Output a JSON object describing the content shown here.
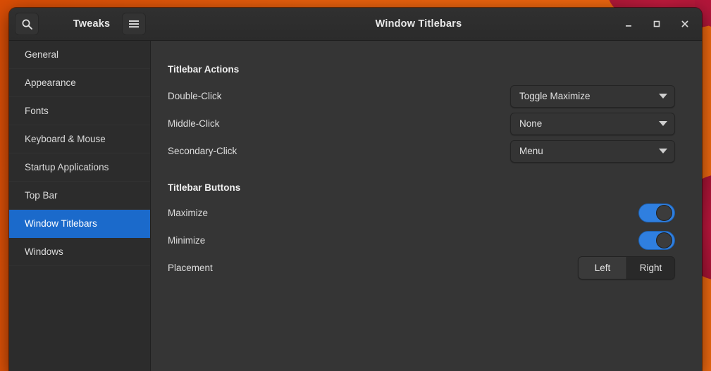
{
  "window": {
    "title": "Window Titlebars",
    "app_name": "Tweaks",
    "search_icon": "search-icon",
    "menu_icon": "hamburger-menu-icon",
    "controls": {
      "minimize": "–",
      "maximize": "□",
      "close": "×"
    }
  },
  "sidebar": {
    "items": [
      {
        "label": "General",
        "selected": false
      },
      {
        "label": "Appearance",
        "selected": false
      },
      {
        "label": "Fonts",
        "selected": false
      },
      {
        "label": "Keyboard & Mouse",
        "selected": false
      },
      {
        "label": "Startup Applications",
        "selected": false
      },
      {
        "label": "Top Bar",
        "selected": false
      },
      {
        "label": "Window Titlebars",
        "selected": true
      },
      {
        "label": "Windows",
        "selected": false
      }
    ]
  },
  "content": {
    "titlebar_actions": {
      "heading": "Titlebar Actions",
      "rows": [
        {
          "label": "Double-Click",
          "value": "Toggle Maximize"
        },
        {
          "label": "Middle-Click",
          "value": "None"
        },
        {
          "label": "Secondary-Click",
          "value": "Menu"
        }
      ]
    },
    "titlebar_buttons": {
      "heading": "Titlebar Buttons",
      "maximize": {
        "label": "Maximize",
        "state": "on"
      },
      "minimize": {
        "label": "Minimize",
        "state": "on"
      },
      "placement": {
        "label": "Placement",
        "options": [
          "Left",
          "Right"
        ],
        "selected": "Right"
      }
    }
  },
  "colors": {
    "accent": "#1b6acb",
    "switch_on": "#2f7fe0",
    "desktop": "#e8590c",
    "window_bg": "#353535",
    "sidebar_bg": "#2c2c2c"
  }
}
